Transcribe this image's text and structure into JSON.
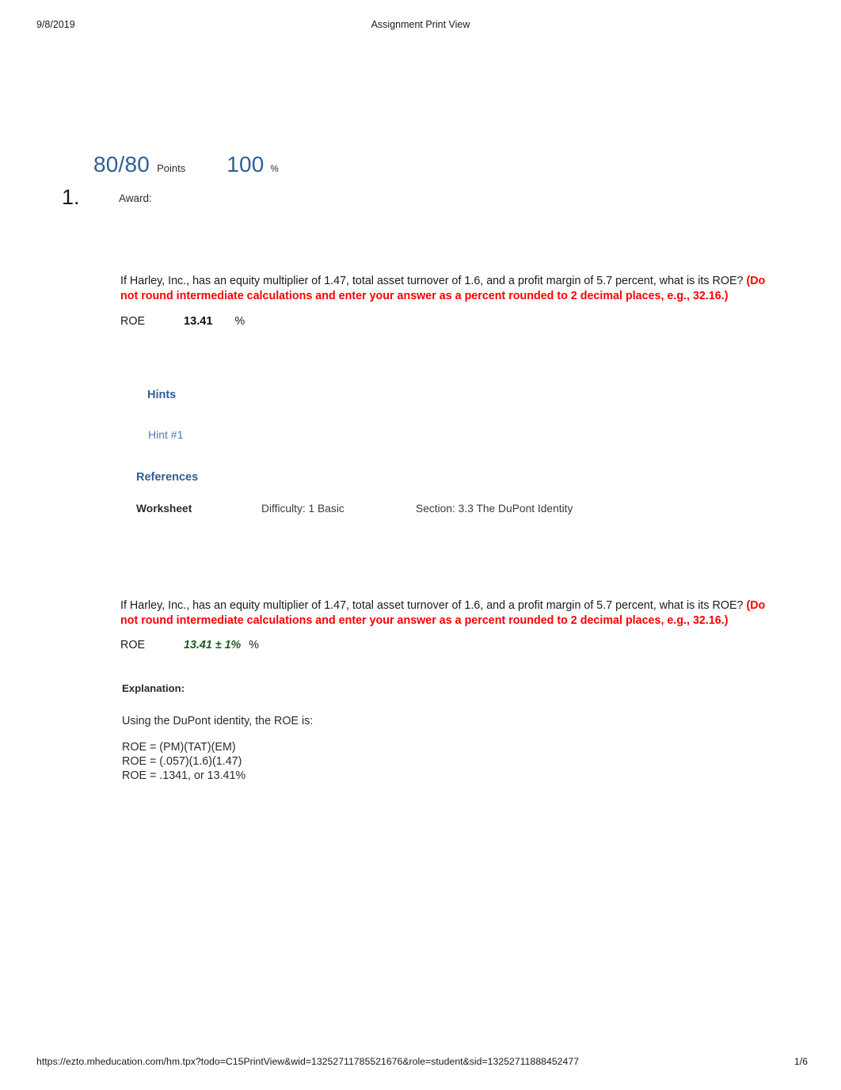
{
  "print_header": {
    "date": "9/8/2019",
    "title": "Assignment Print View"
  },
  "score": {
    "points": "80/80",
    "points_label": "Points",
    "percent": "100",
    "percent_sign": "%"
  },
  "question": {
    "number": "1.",
    "award_label": "Award:",
    "prompt_main": "If Harley, Inc., has an equity multiplier of 1.47, total asset turnover of 1.6, and a profit margin of 5.7 percent, what is its ROE? ",
    "prompt_emphasis": "(Do not round intermediate calculations and enter your answer as a percent rounded to 2 decimal places, e.g., 32.16.)",
    "answer_label": "ROE",
    "answer_value_student": "13.41",
    "answer_unit": "%",
    "answer_value_key": "13.41 ± 1%",
    "answer_unit_key": "%"
  },
  "hints": {
    "heading": "Hints",
    "link_label": "Hint #1"
  },
  "references": {
    "heading": "References",
    "worksheet": "Worksheet",
    "difficulty": "Difficulty: 1 Basic",
    "section": "Section: 3.3 The DuPont Identity"
  },
  "explanation": {
    "heading": "Explanation:",
    "intro": "Using the DuPont identity, the ROE is:",
    "line_1": "ROE = (PM)(TAT)(EM)",
    "line_2": "ROE = (.057)(1.6)(1.47)",
    "line_3": "ROE = .1341, or 13.41%"
  },
  "print_footer": {
    "url": "https://ezto.mheducation.com/hm.tpx?todo=C15PrintView&wid=13252711785521676&role=student&sid=13252711888452477",
    "page": "1/6"
  },
  "colors": {
    "accent_blue": "#2f6094",
    "link_blue": "#4a7ab0",
    "emphasis_red": "#ff0000",
    "answer_green": "#1d5c22"
  }
}
